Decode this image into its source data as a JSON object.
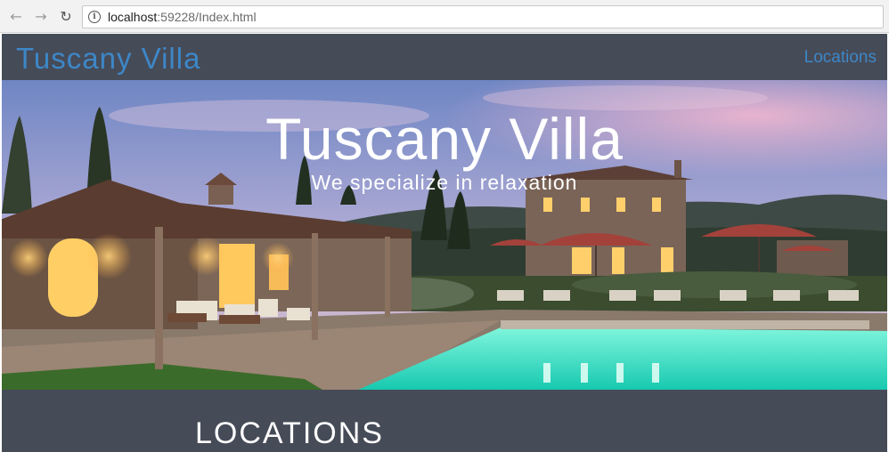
{
  "browser": {
    "url_host": "localhost",
    "url_rest": ":59228/Index.html"
  },
  "header": {
    "brand": "Tuscany Villa",
    "nav_link": "Locations"
  },
  "hero": {
    "title": "Tuscany Villa",
    "subtitle": "We specialize in relaxation"
  },
  "locations": {
    "heading": "LOCATIONS"
  },
  "colors": {
    "page_bg": "#464b58",
    "link_blue": "#3d87c7",
    "pool": "#2fe6c6"
  }
}
